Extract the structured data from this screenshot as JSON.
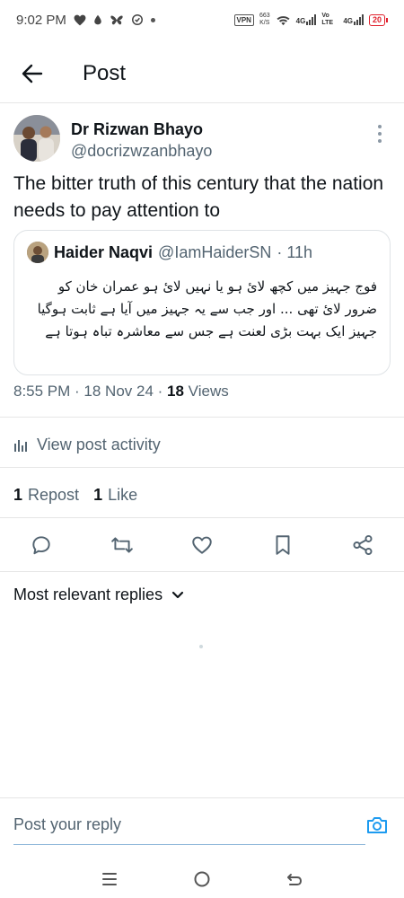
{
  "status_bar": {
    "time": "9:02 PM",
    "vpn": "VPN",
    "speed_value": "663",
    "speed_unit": "K/S",
    "network1": "4G",
    "network2": "Vo LTE",
    "network3": "4G",
    "battery": "20"
  },
  "header": {
    "title": "Post"
  },
  "tweet": {
    "author_name": "Dr Rizwan Bhayo",
    "author_handle": "@docrizwzanbhayo",
    "text": "The bitter truth of this century that the nation needs to pay attention to",
    "timestamp": "8:55 PM · 18 Nov 24 · ",
    "views_count": "18",
    "views_label": " Views"
  },
  "quote": {
    "author_name": "Haider Naqvi",
    "author_handle": "@IamHaiderSN",
    "time": "· 11h",
    "text": "فوج جہیز میں کچھ لائ ہو یا نہیں لائ ہو عمران خان کو ضرور لائ تھی ... اور جب سے یہ جہیز میں آیا ہے ثابت ہوگیا جہیز ایک بہت بڑی لعنت ہے جس سے معاشرہ تباہ ہوتا ہے"
  },
  "activity": {
    "label": "View post activity"
  },
  "stats": {
    "reposts_count": "1",
    "reposts_label": "Repost",
    "likes_count": "1",
    "likes_label": "Like"
  },
  "replies": {
    "sort_label": "Most relevant replies"
  },
  "reply_bar": {
    "placeholder": "Post your reply"
  },
  "colors": {
    "accent": "#1d9bf0",
    "secondary_text": "#536471",
    "battery_low": "#e0202c"
  }
}
